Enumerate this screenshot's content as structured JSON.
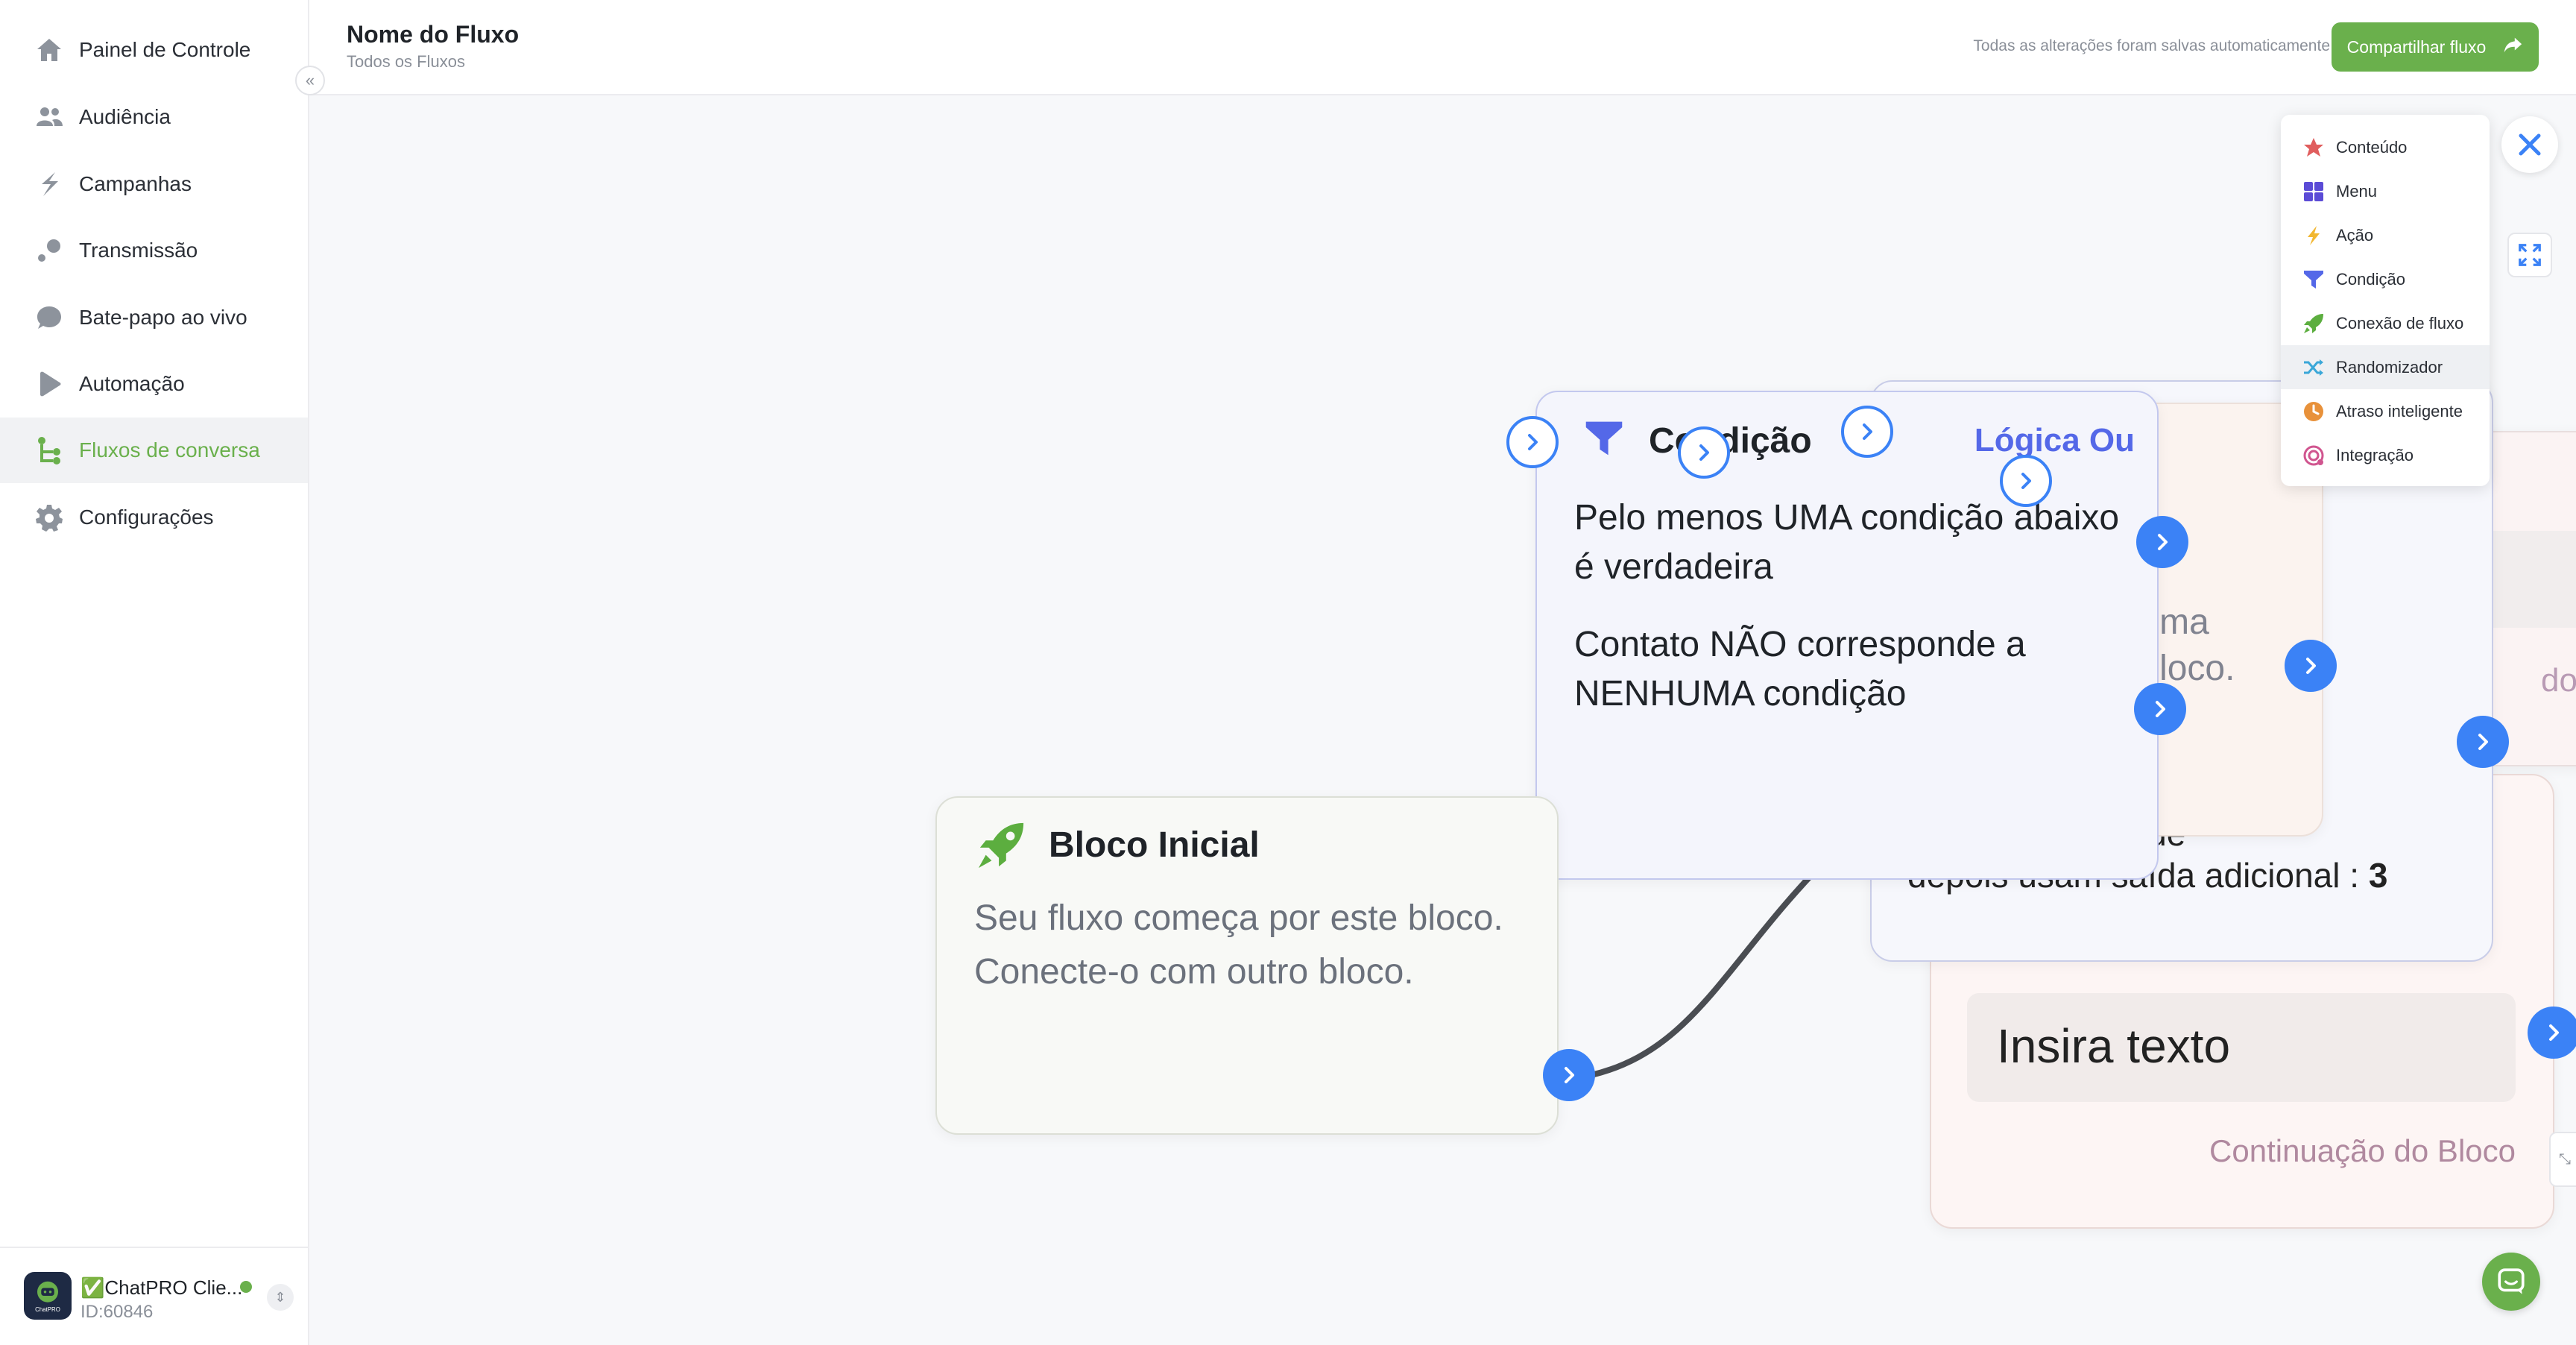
{
  "sidebar": {
    "items": [
      {
        "label": "Painel de Controle",
        "icon": "home-icon"
      },
      {
        "label": "Audiência",
        "icon": "users-icon"
      },
      {
        "label": "Campanhas",
        "icon": "campaign-icon"
      },
      {
        "label": "Transmissão",
        "icon": "broadcast-icon"
      },
      {
        "label": "Bate-papo ao vivo",
        "icon": "chat-bubble-icon"
      },
      {
        "label": "Automação",
        "icon": "play-icon"
      },
      {
        "label": "Fluxos de conversa",
        "icon": "flow-icon"
      },
      {
        "label": "Configurações",
        "icon": "gear-icon"
      }
    ],
    "active_index": 6,
    "collapse_icon": "double-chevron-left-icon",
    "account": {
      "name": "✅ChatPRO Clie...",
      "id": "ID:60846",
      "status": "online",
      "avatar_text": "ChatPRO"
    }
  },
  "header": {
    "title": "Nome do Fluxo",
    "breadcrumb": "Todos os Fluxos",
    "autosave": "Todas as alterações foram salvas automaticamente",
    "share_label": "Compartilhar fluxo",
    "share_icon": "share-arrow-icon"
  },
  "nodes": {
    "start": {
      "title": "Bloco Inicial",
      "line1": "Seu fluxo começa por este bloco.",
      "line2": "Conecte-o com outro bloco."
    },
    "condition": {
      "title": "Condição",
      "logic": "Lógica Ou",
      "opt1_l1": "Pelo menos UMA condição abaixo",
      "opt1_l2": "é verdadeira",
      "opt2_l1": "Contato NÃO corresponde a",
      "opt2_l2": "NENHUMA condição"
    },
    "behind_a": {
      "frag1": "nhuma",
      "frag2": "te bloco."
    },
    "behind_b": {
      "line1": "uade de erros que",
      "line2": "depois usam saída adicional :",
      "count": "3"
    },
    "behind_c": {
      "frag": "do Blo"
    },
    "text_block": {
      "placeholder": "Insira texto",
      "continuation": "Continuação do Bloco"
    }
  },
  "palette": {
    "items": [
      {
        "label": "Conteúdo",
        "icon": "star-icon",
        "color": "#e05d5d"
      },
      {
        "label": "Menu",
        "icon": "grid-icon",
        "color": "#5b4bd6"
      },
      {
        "label": "Ação",
        "icon": "lightning-icon",
        "color": "#f2b731"
      },
      {
        "label": "Condição",
        "icon": "filter-icon",
        "color": "#5468e8"
      },
      {
        "label": "Conexão de fluxo",
        "icon": "rocket-icon",
        "color": "#5cae3f"
      },
      {
        "label": "Randomizador",
        "icon": "shuffle-icon",
        "color": "#3aa7d8"
      },
      {
        "label": "Atraso inteligente",
        "icon": "clock-icon",
        "color": "#e8913a"
      },
      {
        "label": "Integração",
        "icon": "integration-icon",
        "color": "#d0558f"
      }
    ],
    "highlight_index": 5
  },
  "colors": {
    "brand_green": "#6ab04c",
    "port_blue": "#3b82f6",
    "condition_blue": "#5468e8"
  }
}
